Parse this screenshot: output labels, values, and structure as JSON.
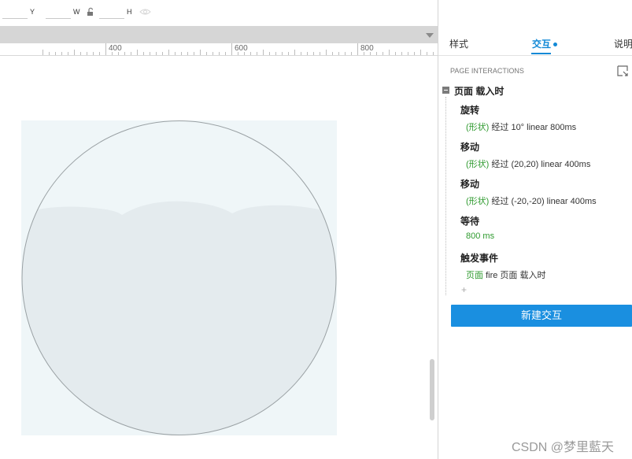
{
  "toolbar": {
    "y_label": "Y",
    "w_label": "W",
    "h_label": "H",
    "lock_icon": "unlock-icon",
    "eye_icon": "eye-icon"
  },
  "ruler": {
    "labels": [
      "400",
      "600",
      "800"
    ]
  },
  "panel": {
    "tabs": [
      {
        "label": "样式",
        "active": false
      },
      {
        "label": "交互",
        "active": true
      },
      {
        "label": "说明",
        "active": false
      }
    ],
    "section_title": "PAGE INTERACTIONS",
    "event_title": "页面 载入时",
    "actions": [
      {
        "name": "旋转",
        "target": "(形状)",
        "detail": "经过 10° linear 800ms"
      },
      {
        "name": "移动",
        "target": "(形状)",
        "detail": "经过 (20,20) linear 400ms"
      },
      {
        "name": "移动",
        "target": "(形状)",
        "detail": "经过 (-20,-20) linear 400ms"
      },
      {
        "name": "等待",
        "target": "800 ms",
        "detail": ""
      },
      {
        "name": "触发事件",
        "target": "页面",
        "detail": "fire 页面 载入时"
      }
    ],
    "add_label": "+",
    "new_button": "新建交互"
  },
  "colors": {
    "accent": "#1289d6",
    "button": "#1a8fe0",
    "green": "#2e9a2e",
    "panel_bg": "#eff6f8",
    "fill": "#e4ebee"
  },
  "watermark": "CSDN @梦里藍天"
}
